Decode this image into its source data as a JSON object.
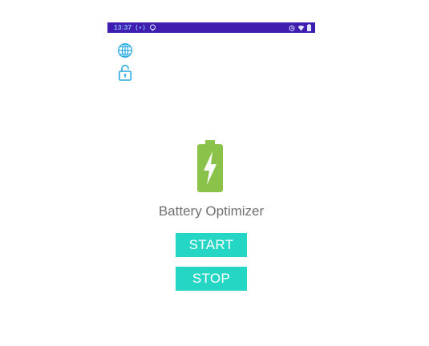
{
  "status_bar": {
    "time": "13:37",
    "notification_icons": [
      "wifi-hotspot-icon",
      "cloud-icon"
    ],
    "system_icons": [
      "alarm-icon",
      "wifi-icon",
      "battery-icon"
    ]
  },
  "toolbar": {
    "language_icon": "globe-icon",
    "lock_icon": "lock-icon"
  },
  "app": {
    "logo_icon": "battery-charging-icon",
    "title": "Battery Optimizer",
    "start_label": "START",
    "stop_label": "STOP"
  },
  "colors": {
    "status_bar_bg": "#3f1db0",
    "button_bg": "#26d6c5",
    "battery_green": "#8bc34a",
    "icon_blue": "#29a9e1",
    "title_text": "#6f6f6f"
  }
}
